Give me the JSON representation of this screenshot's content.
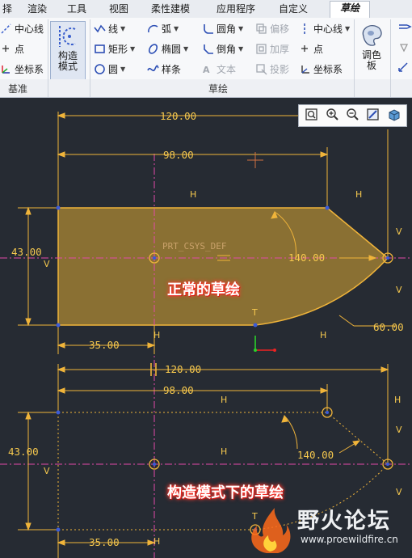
{
  "tabs": [
    {
      "label": "择",
      "active": false
    },
    {
      "label": "渲染",
      "active": false
    },
    {
      "label": "工具",
      "active": false
    },
    {
      "label": "视图",
      "active": false
    },
    {
      "label": "柔性建模",
      "active": false
    },
    {
      "label": "应用程序",
      "active": false
    },
    {
      "label": "自定义",
      "active": false
    },
    {
      "label": "草绘",
      "active": true
    }
  ],
  "ribbon": {
    "datum": {
      "centerline": "中心线",
      "point": "点",
      "csys": "坐标系",
      "group": "基准"
    },
    "construct_mode": "构造\n模式",
    "sketch": {
      "line": "线",
      "rectangle": "矩形",
      "circle": "圆",
      "arc": "弧",
      "ellipse": "椭圆",
      "spline": "样条",
      "fillet": "圆角",
      "chamfer": "倒角",
      "text": "文本",
      "offset": "偏移",
      "thicken": "加厚",
      "project": "投影",
      "centerline": "中心线",
      "point": "点",
      "csys": "坐标系",
      "palette": "调色\n板",
      "group": "草绘"
    }
  },
  "view_toolbar": [
    "refit-icon",
    "zoom-in-icon",
    "zoom-out-icon",
    "repaint-icon",
    "display-style-icon"
  ],
  "sketch_top": {
    "dim_120": "120.00",
    "dim_98": "98.00",
    "dim_43": "43.00",
    "dim_140": "140.00",
    "dim_35": "35.00",
    "dim_60": "60.00",
    "csys_label": "PRT_CSYS_DEF",
    "caption": "正常的草绘",
    "c_H": "H",
    "c_V": "V",
    "c_T": "T"
  },
  "sketch_bottom": {
    "dim_120": "120.00",
    "dim_98": "98.00",
    "dim_43": "43.00",
    "dim_140": "140.00",
    "dim_35": "35.00",
    "caption": "构造模式下的草绘",
    "c_H": "H",
    "c_V": "V",
    "c_T": "T"
  },
  "colors": {
    "canvas": "#262b33",
    "sketch": "#f0b43a",
    "fill": "#8a7033",
    "vertex": "#3b5bd8",
    "caption_glow": "#ff3a2f"
  },
  "watermark": {
    "title": "野火论坛",
    "url": "www.proewildfire.cn"
  }
}
